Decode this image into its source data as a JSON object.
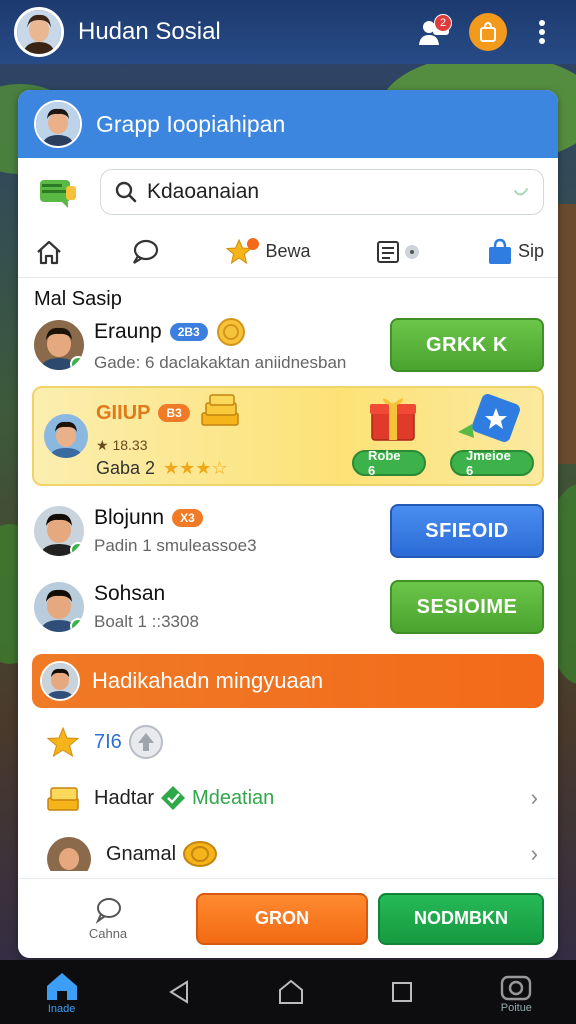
{
  "appbar": {
    "title": "Hudan Sosial",
    "notification_count": "2"
  },
  "panel": {
    "header_title": "Grapp Ioopiahipan",
    "search": {
      "value": "Kdaoanaian"
    },
    "nav": [
      {
        "label": "",
        "icon": "home-icon"
      },
      {
        "label": "",
        "icon": "chat-bubble-icon"
      },
      {
        "label": "Bewa",
        "icon": "star-badge-icon"
      },
      {
        "label": "",
        "icon": "news-icon"
      },
      {
        "label": "Sip",
        "icon": "shop-bag-icon"
      }
    ],
    "section_title": "Mal Sasip",
    "rows": [
      {
        "name": "Eraunp",
        "pill": "2B3",
        "sub": "Gade: 6 daclakaktan aniidnesban",
        "button": "GRKK K",
        "button_color": "green"
      }
    ],
    "featured": {
      "name": "GIIUP",
      "pill": "B3",
      "line1": "★ 18.33",
      "line2": "Gaba 2",
      "stars": "★★★☆",
      "reward1": "Robe 6",
      "reward2": "Jmeioe 6"
    },
    "rows2": [
      {
        "name": "Blojunn",
        "pill": "X3",
        "sub": "Padin 1 smuleassoe3",
        "button": "SFIEOID",
        "button_color": "blue"
      },
      {
        "name": "Sohsan",
        "pill": "",
        "sub": "Boalt 1 ::3308",
        "button": "SESIOIME",
        "button_color": "green"
      }
    ],
    "orange_bar": "Hadikahadn mingyuaan",
    "list": [
      {
        "label": "7I6",
        "icon": "star-icon"
      },
      {
        "label": "Hadtar",
        "label2": "Mdeatian",
        "icon": "coins-stack-icon"
      },
      {
        "label": "Gnamal",
        "icon": "coin-icon"
      }
    ],
    "bottom": {
      "camera_label": "Cahna",
      "orange_button": "GRON",
      "green_button": "NODMBKN"
    }
  },
  "sysnav": [
    {
      "label": "Inade",
      "icon": "home-icon",
      "active": true
    },
    {
      "label": "",
      "icon": "back-icon"
    },
    {
      "label": "",
      "icon": "home-outline-icon"
    },
    {
      "label": "",
      "icon": "recents-icon"
    },
    {
      "label": "Poitue",
      "icon": "camera-icon"
    }
  ],
  "colors": {
    "header_blue": "#3d86e0",
    "green": "#4aa32e",
    "blue": "#2c6bd6",
    "orange": "#f26a1a"
  }
}
